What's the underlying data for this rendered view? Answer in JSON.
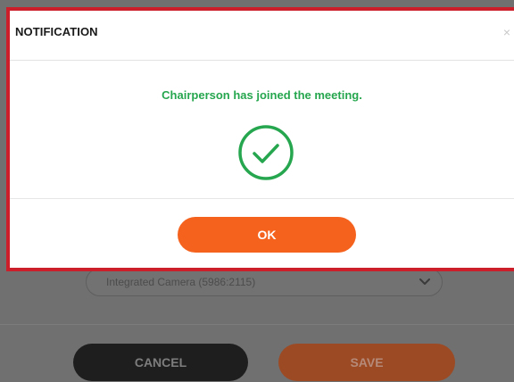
{
  "background": {
    "camera_select_value": "Integrated Camera (5986:2115)",
    "cancel_label": "CANCEL",
    "save_label": "SAVE"
  },
  "modal": {
    "title": "NOTIFICATION",
    "close_glyph": "×",
    "message": "Chairperson has joined the meeting.",
    "ok_label": "OK"
  },
  "icons": {
    "success": "check-circle-icon",
    "close": "close-icon",
    "dropdown": "chevron-down-icon"
  },
  "colors": {
    "accent_orange": "#f5621e",
    "success_green": "#26a64e",
    "highlight_red": "#cc1e2a"
  }
}
